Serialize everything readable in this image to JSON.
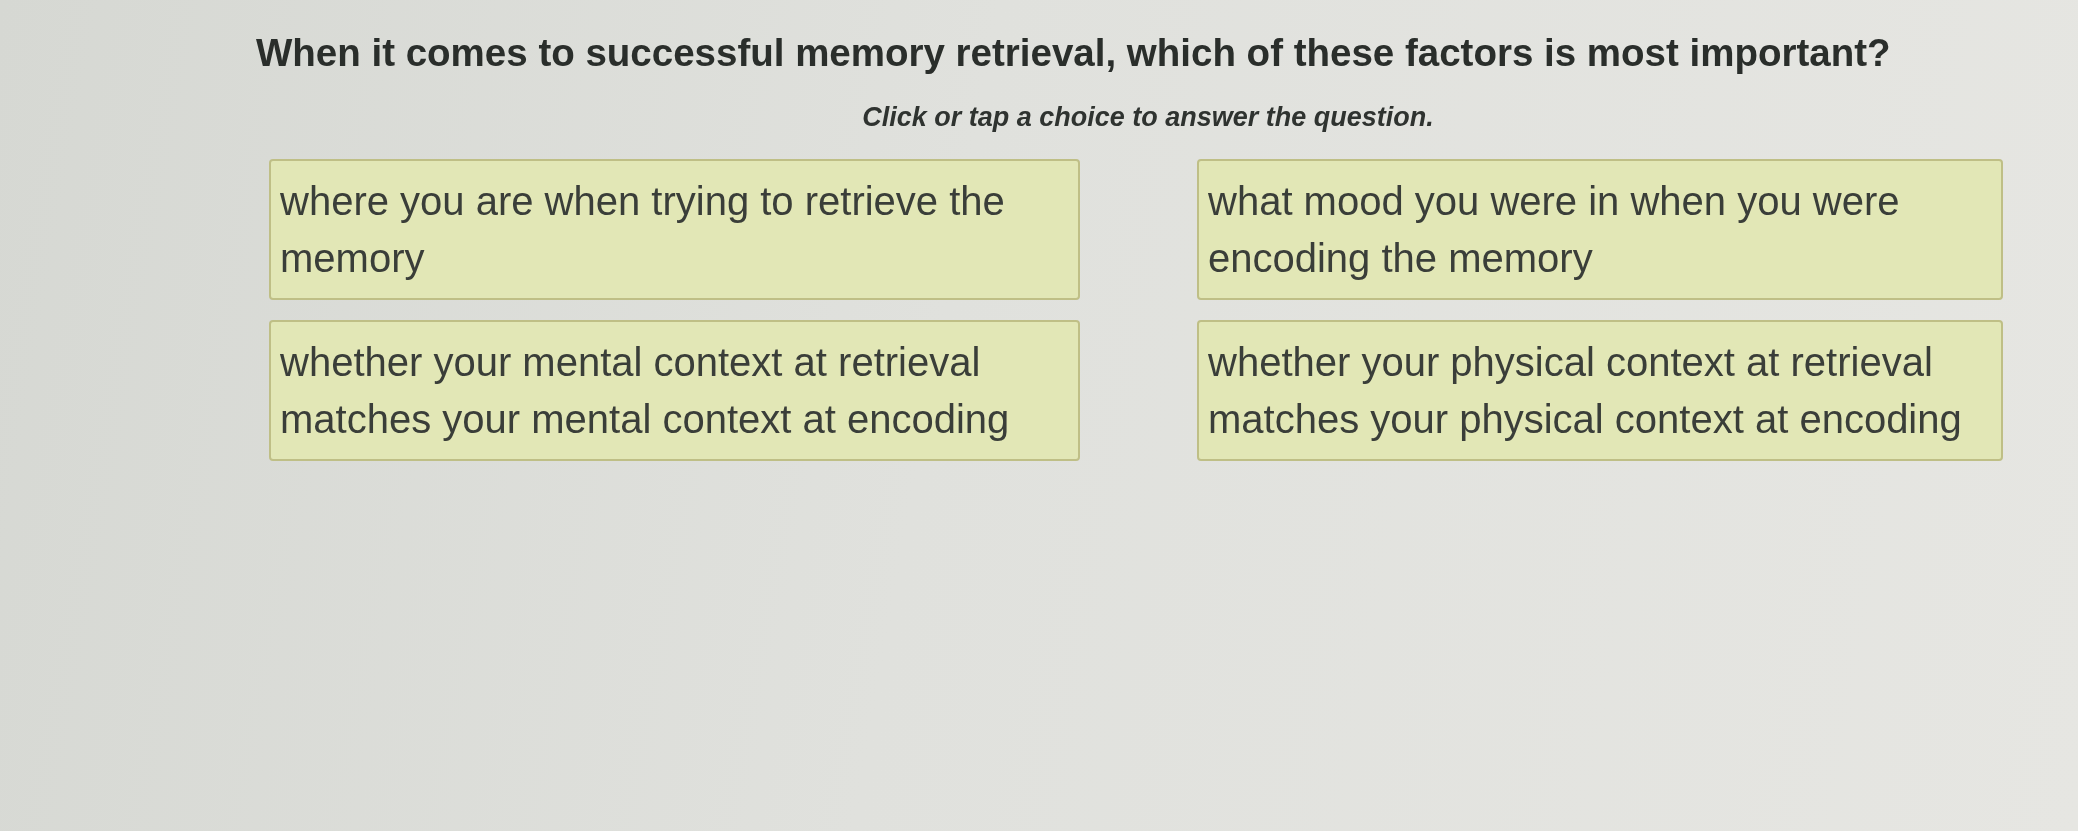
{
  "question": {
    "text": "When it comes to successful memory retrieval, which of these factors is most important?",
    "instruction": "Click or tap a choice to answer the question."
  },
  "choices": [
    {
      "text": "where you are when trying to retrieve the memory",
      "selected": false
    },
    {
      "text": "what mood you were in when you were encoding the memory",
      "selected": false
    },
    {
      "text": "whether your mental context at retrieval matches your mental context at encoding",
      "selected": false
    },
    {
      "text": "whether your physical context at retrieval matches your physical context at encoding",
      "selected": false
    }
  ]
}
